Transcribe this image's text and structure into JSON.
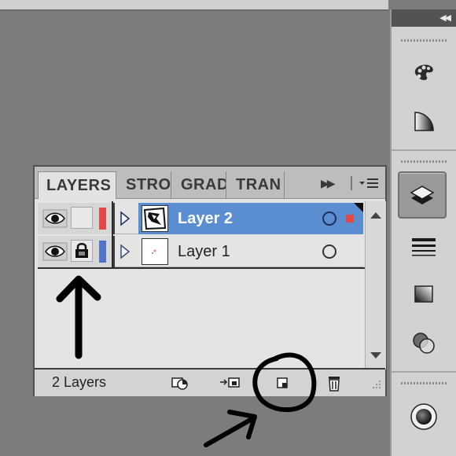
{
  "panel": {
    "tabs": [
      {
        "label": "LAYERS",
        "active": true
      },
      {
        "label": "STRO",
        "active": false
      },
      {
        "label": "GRAD",
        "active": false
      },
      {
        "label": "TRAN",
        "active": false
      }
    ],
    "layers": [
      {
        "name": "Layer 2",
        "selected": true,
        "visible": true,
        "locked": false,
        "color": "#e24848"
      },
      {
        "name": "Layer 1",
        "selected": false,
        "visible": true,
        "locked": true,
        "color": "#4f74c8"
      }
    ],
    "layer_count": "2 Layers"
  },
  "dock": {
    "icons": [
      "swatches-icon",
      "gradient-icon",
      "layers-icon",
      "stroke-icon",
      "gradient-panel-icon",
      "transparency-icon",
      "appearance-icon"
    ],
    "active": "layers-icon"
  },
  "colors": {
    "selection": "#5b8ed0",
    "layer2_color": "#e24848",
    "layer1_color": "#4f74c8"
  }
}
